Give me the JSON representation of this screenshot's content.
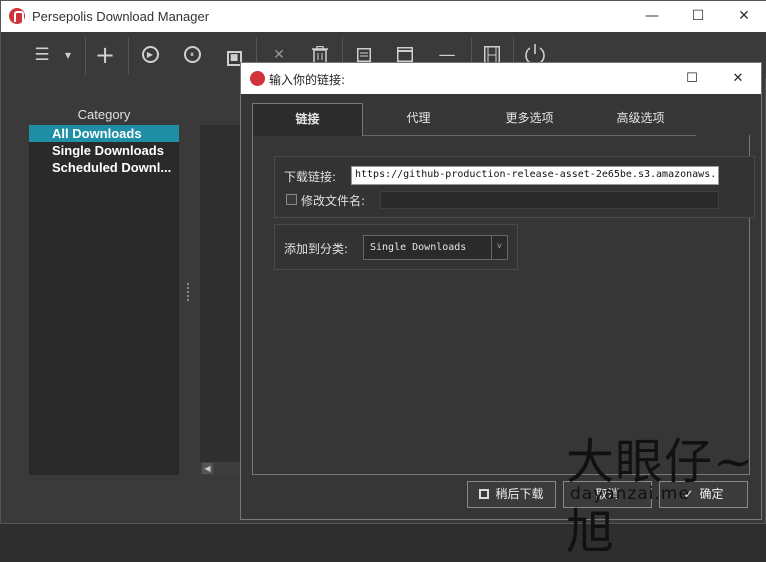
{
  "window": {
    "title": "Persepolis Download Manager",
    "minimize": "—",
    "maximize": "☐",
    "close": "✕"
  },
  "toolbar": {
    "menu_icon": "☰",
    "dropdown_icon": "▾",
    "add_icon": "+",
    "play_icon": "▶",
    "pause_icon": "⏸",
    "stop_icon": "■",
    "remove_icon": "✕",
    "delete_icon": "🗑",
    "properties_icon": "▤",
    "window_icon": "▭",
    "minimize_icon": "—",
    "video_icon": "🎞",
    "shutdown_icon": "⏻"
  },
  "sidebar": {
    "heading": "Category",
    "items": [
      {
        "label": "All Downloads",
        "active": true
      },
      {
        "label": "Single Downloads",
        "active": false
      },
      {
        "label": "Scheduled Downl...",
        "active": false
      }
    ]
  },
  "dialog": {
    "title": "输入你的链接:",
    "maximize": "☐",
    "close": "✕",
    "tabs": [
      {
        "label": "链接",
        "active": true
      },
      {
        "label": "代理",
        "active": false
      },
      {
        "label": "更多选项",
        "active": false
      },
      {
        "label": "高级选项",
        "active": false
      }
    ],
    "link_label": "下载链接:",
    "link_value": "https://github-production-release-asset-2e65be.s3.amazonaws.",
    "rename_label": "修改文件名:",
    "rename_value": "",
    "category_label": "添加到分类:",
    "category_value": "Single Downloads",
    "buttons": {
      "later": "稍后下载",
      "cancel": "取消",
      "ok": "确定"
    }
  },
  "watermark": {
    "big": "大眼仔~旭",
    "small": "dayanzai.me"
  },
  "colors": {
    "accent": "#1f8fa6",
    "brand": "#d0333a"
  }
}
